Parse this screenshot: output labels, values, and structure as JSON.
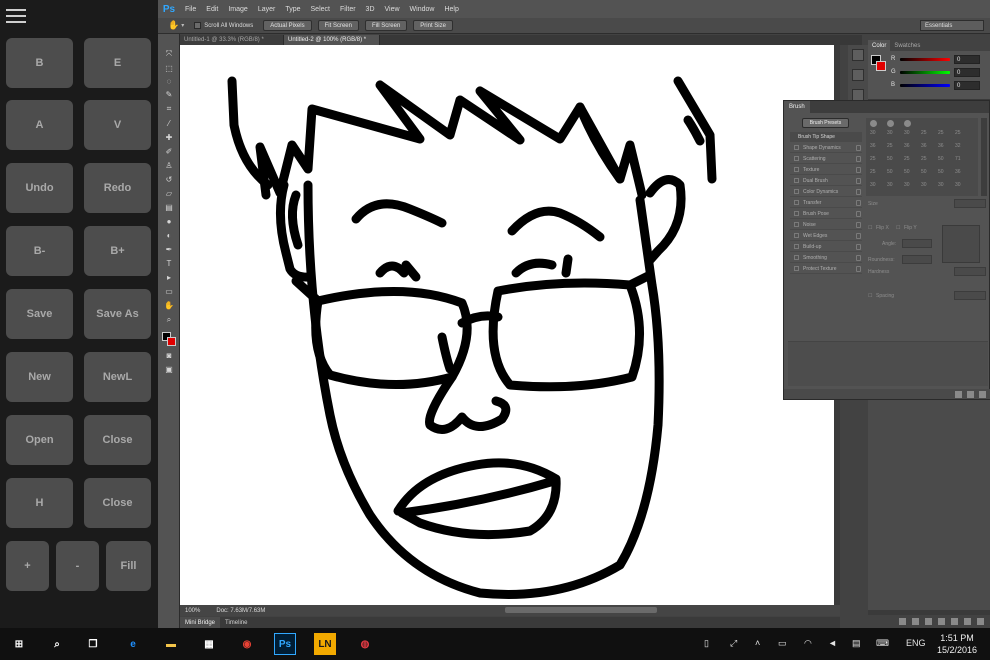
{
  "left_panel": {
    "buttons": [
      {
        "label": "B"
      },
      {
        "label": "E"
      },
      {
        "label": "A"
      },
      {
        "label": "V"
      },
      {
        "label": "Undo"
      },
      {
        "label": "Redo"
      },
      {
        "label": "B-"
      },
      {
        "label": "B+"
      },
      {
        "label": "Save"
      },
      {
        "label": "Save As"
      },
      {
        "label": "New"
      },
      {
        "label": "NewL"
      },
      {
        "label": "Open"
      },
      {
        "label": "Close"
      },
      {
        "label": "H"
      },
      {
        "label": "Close"
      },
      {
        "label": "+"
      },
      {
        "label": "-"
      },
      {
        "label": "Fill"
      }
    ]
  },
  "photoshop": {
    "logo": "Ps",
    "menu": [
      "File",
      "Edit",
      "Image",
      "Layer",
      "Type",
      "Select",
      "Filter",
      "3D",
      "View",
      "Window",
      "Help"
    ],
    "options": {
      "scroll_all_windows": "Scroll All Windows",
      "actual_pixels": "Actual Pixels",
      "fit_screen": "Fit Screen",
      "fill_screen": "Fill Screen",
      "print_size": "Print Size",
      "workspace": "Essentials"
    },
    "doc_tabs": [
      {
        "label": "Untitled-1 @ 33.3% (RGB/8) *",
        "active": false
      },
      {
        "label": "Untitled-2 @ 100% (RGB/8) *",
        "active": true
      }
    ],
    "status": {
      "zoom": "100%",
      "doc": "Doc: 7.63M/7.63M"
    },
    "bottom_tabs": [
      "Mini Bridge",
      "Timeline"
    ],
    "color_panel": {
      "tabs": [
        "Color",
        "Swatches"
      ],
      "foreground": "#000000",
      "background": "#e00000",
      "channels": [
        {
          "label": "R",
          "value": "0"
        },
        {
          "label": "G",
          "value": "0"
        },
        {
          "label": "B",
          "value": "0"
        }
      ]
    },
    "brush_panel": {
      "tab": "Brush",
      "presets_button": "Brush Presets",
      "options": [
        "Brush Tip Shape",
        "Shape Dynamics",
        "Scattering",
        "Texture",
        "Dual Brush",
        "Color Dynamics",
        "Transfer",
        "Brush Pose",
        "Noise",
        "Wet Edges",
        "Build-up",
        "Smoothing",
        "Protect Texture"
      ],
      "tip_sizes": [
        [
          "30",
          "30",
          "30",
          "25",
          "25",
          "25"
        ],
        [
          "36",
          "25",
          "36",
          "36",
          "36",
          "32"
        ],
        [
          "25",
          "50",
          "25",
          "25",
          "50",
          "71"
        ],
        [
          "25",
          "50",
          "50",
          "50",
          "50",
          "36"
        ],
        [
          "30",
          "30",
          "30",
          "30",
          "30",
          "30"
        ]
      ],
      "size_label": "Size",
      "flip_x": "Flip X",
      "flip_y": "Flip Y",
      "angle_label": "Angle:",
      "roundness_label": "Roundness:",
      "hardness_label": "Hardness",
      "spacing_label": "Spacing"
    }
  },
  "taskbar": {
    "time": "1:51 PM",
    "date": "15/2/2016",
    "language": "ENG",
    "ps_icon": "Ps",
    "ln_icon": "LN"
  }
}
